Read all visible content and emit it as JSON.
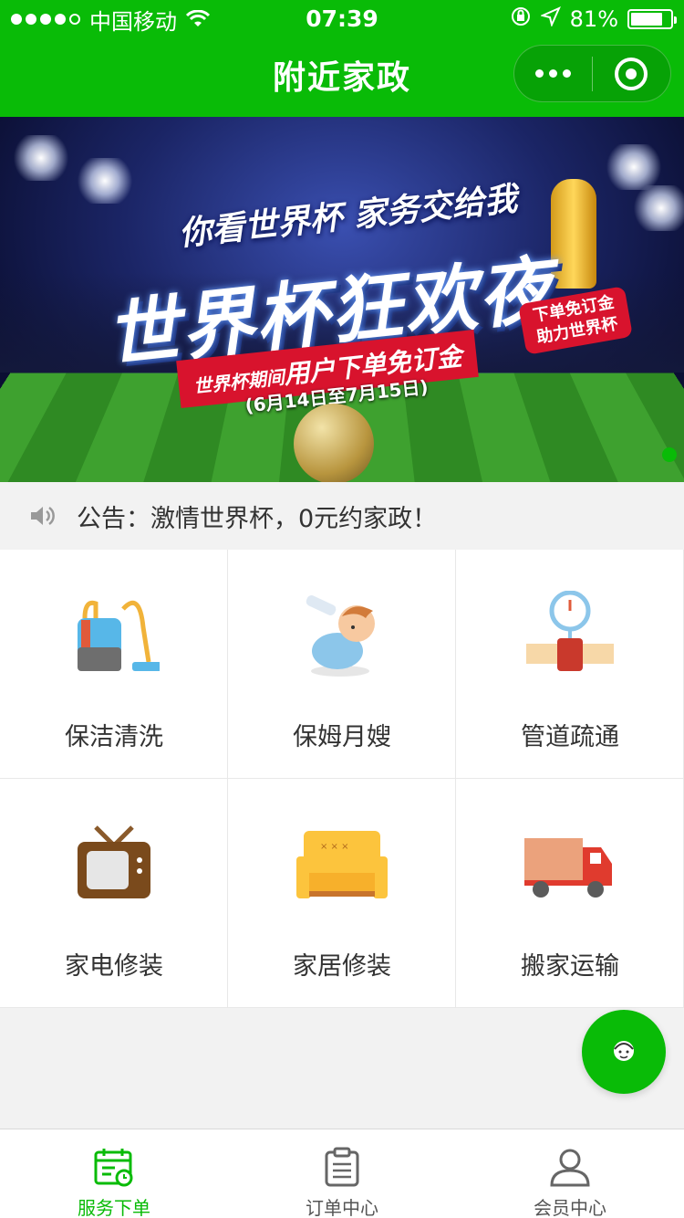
{
  "status_bar": {
    "carrier": "中国移动",
    "time": "07:39",
    "battery": "81%",
    "battery_level": 0.81
  },
  "nav": {
    "title": "附近家政"
  },
  "banner": {
    "subtitle": "你看世界杯 家务交给我",
    "headline": "世界杯狂欢夜",
    "ribbon_prefix": "世界杯期间",
    "ribbon_main": "用户下单免订金",
    "dates": "(6月14日至7月15日)",
    "badge_line1": "下单免订金",
    "badge_line2": "助力世界杯"
  },
  "notice": {
    "text": "公告：激情世界杯，0元约家政！"
  },
  "services": [
    {
      "label": "保洁清洗",
      "icon": "vacuum-icon"
    },
    {
      "label": "保姆月嫂",
      "icon": "baby-icon"
    },
    {
      "label": "管道疏通",
      "icon": "pipe-icon"
    },
    {
      "label": "家电修装",
      "icon": "tv-icon"
    },
    {
      "label": "家居修装",
      "icon": "sofa-icon"
    },
    {
      "label": "搬家运输",
      "icon": "truck-icon"
    }
  ],
  "tabs": [
    {
      "label": "服务下单",
      "icon": "calendar-icon",
      "active": true
    },
    {
      "label": "订单中心",
      "icon": "clipboard-icon",
      "active": false
    },
    {
      "label": "会员中心",
      "icon": "user-icon",
      "active": false
    }
  ],
  "colors": {
    "brand": "#09bb07",
    "ribbon": "#d8132d"
  }
}
